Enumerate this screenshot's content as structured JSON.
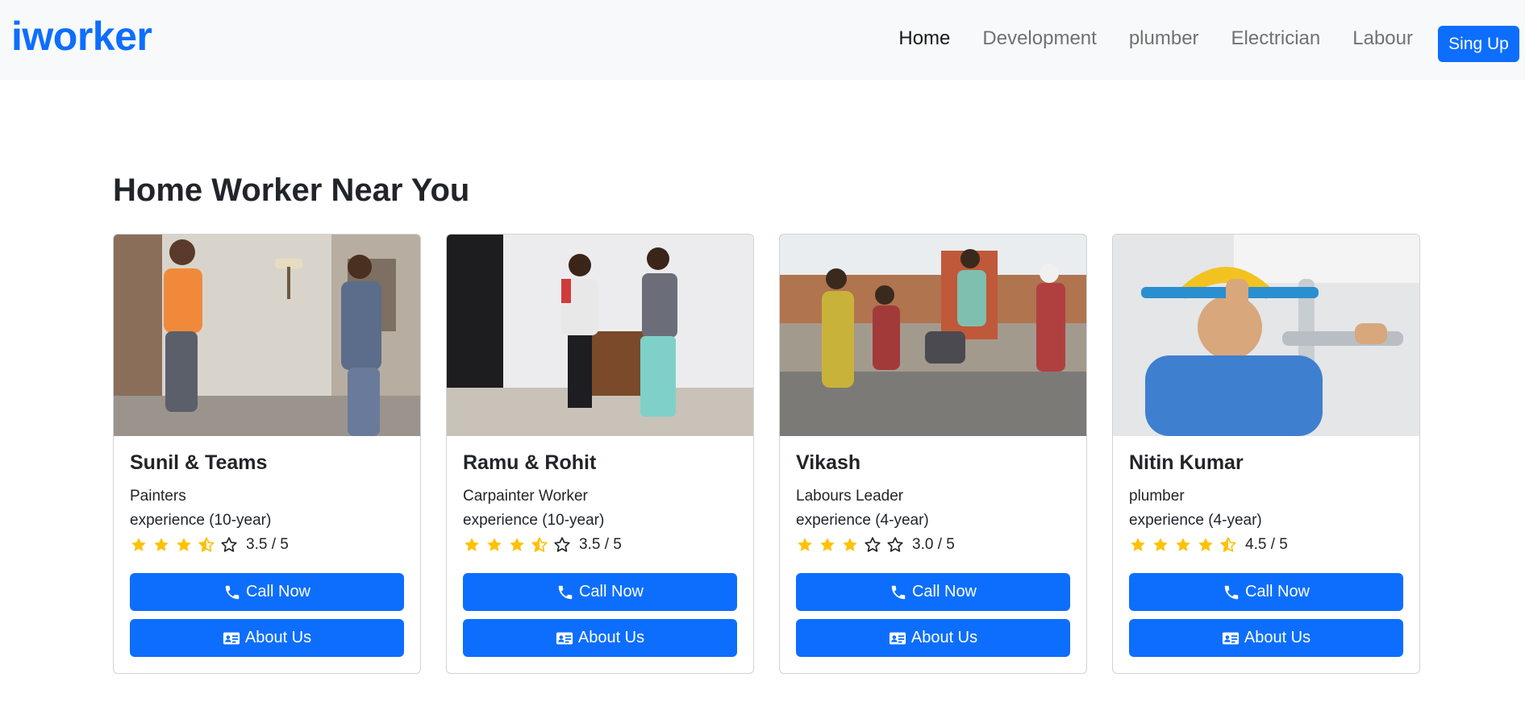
{
  "navbar": {
    "brand": "iworker",
    "links": [
      {
        "label": "Home",
        "active": true
      },
      {
        "label": "Development",
        "active": false
      },
      {
        "label": "plumber",
        "active": false
      },
      {
        "label": "Electrician",
        "active": false
      },
      {
        "label": "Labour",
        "active": false
      }
    ],
    "signup_label": "Sing Up"
  },
  "section": {
    "title": "Home Worker Near You"
  },
  "cards": [
    {
      "name": "Sunil & Teams",
      "role": "Painters",
      "experience": "experience (10-year)",
      "rating": 3.5,
      "rating_text": "3.5 / 5",
      "call_label": "Call Now",
      "about_label": "About Us",
      "image_subject": "painters-photo"
    },
    {
      "name": "Ramu & Rohit",
      "role": "Carpainter Worker",
      "experience": "experience (10-year)",
      "rating": 3.5,
      "rating_text": "3.5 / 5",
      "call_label": "Call Now",
      "about_label": "About Us",
      "image_subject": "carpenters-photo"
    },
    {
      "name": "Vikash",
      "role": "Labours Leader",
      "experience": "experience (4-year)",
      "rating": 3.0,
      "rating_text": "3.0 / 5",
      "call_label": "Call Now",
      "about_label": "About Us",
      "image_subject": "labourers-photo"
    },
    {
      "name": "Nitin Kumar",
      "role": "plumber",
      "experience": "experience (4-year)",
      "rating": 4.5,
      "rating_text": "4.5 / 5",
      "call_label": "Call Now",
      "about_label": "About Us",
      "image_subject": "plumber-photo"
    }
  ],
  "colors": {
    "primary": "#0d6efd",
    "navbar_bg": "#f8f9fa",
    "star": "#ffc107"
  }
}
